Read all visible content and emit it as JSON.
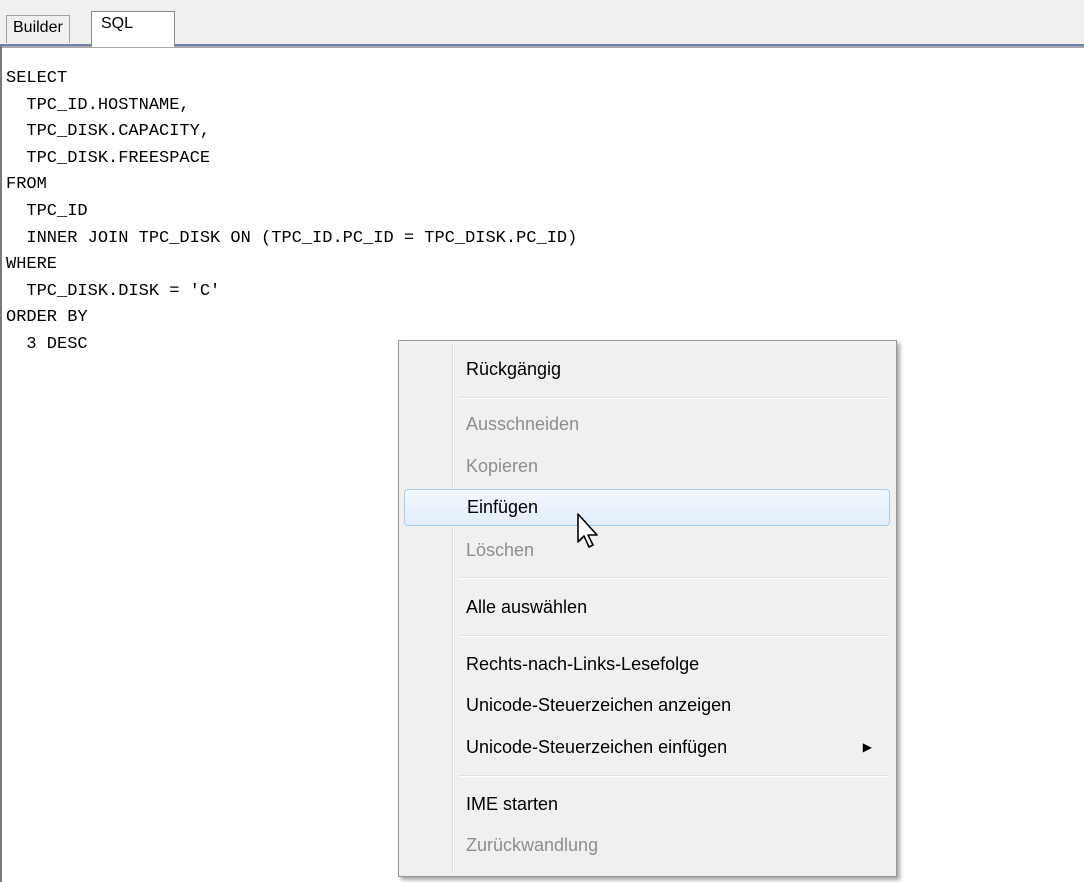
{
  "tabs": [
    {
      "label": "Builder",
      "active": false
    },
    {
      "label": "SQL",
      "active": true
    }
  ],
  "editor": {
    "lines": [
      "SELECT",
      "  TPC_ID.HOSTNAME,",
      "  TPC_DISK.CAPACITY,",
      "  TPC_DISK.FREESPACE",
      "FROM",
      "  TPC_ID",
      "  INNER JOIN TPC_DISK ON (TPC_ID.PC_ID = TPC_DISK.PC_ID)",
      "WHERE",
      "  TPC_DISK.DISK = 'C'",
      "ORDER BY",
      "  3 DESC"
    ]
  },
  "context_menu": {
    "items": [
      {
        "label": "Rückgängig",
        "enabled": true
      },
      {
        "label": "Ausschneiden",
        "enabled": false
      },
      {
        "label": "Kopieren",
        "enabled": false
      },
      {
        "label": "Einfügen",
        "enabled": true,
        "hovered": true
      },
      {
        "label": "Löschen",
        "enabled": false
      },
      {
        "label": "Alle auswählen",
        "enabled": true
      },
      {
        "label": "Rechts-nach-Links-Lesefolge",
        "enabled": true
      },
      {
        "label": "Unicode-Steuerzeichen anzeigen",
        "enabled": true
      },
      {
        "label": "Unicode-Steuerzeichen einfügen",
        "enabled": true,
        "submenu": true,
        "submenu_icon": "arrow-right-icon"
      },
      {
        "label": "IME starten",
        "enabled": true
      },
      {
        "label": "Zurückwandlung",
        "enabled": false
      }
    ]
  },
  "colors": {
    "hover_border": "#a8cdeb",
    "disabled_text": "#8d8d8d",
    "tab_accent": "#6f82b3"
  }
}
